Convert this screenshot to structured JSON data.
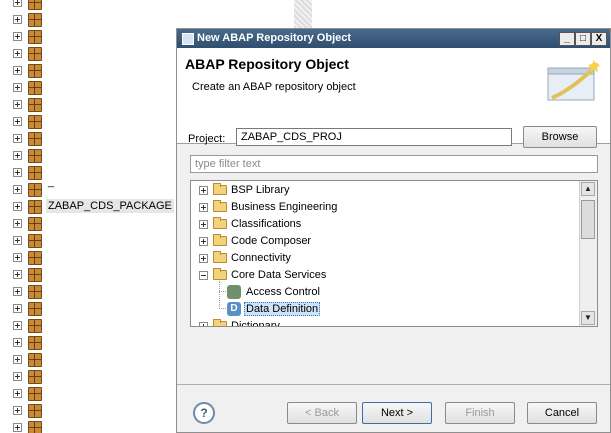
{
  "left_tree": {
    "selected_package": "ZABAP_CDS_PACKAGE",
    "cursor_text": "_"
  },
  "dialog": {
    "window_title": "New ABAP Repository Object",
    "window_buttons": {
      "minimize": "_",
      "maximize": "□",
      "close": "X"
    },
    "banner": {
      "title": "ABAP Repository Object",
      "description": "Create an ABAP repository object"
    },
    "project": {
      "label": "Project:",
      "value": "ZABAP_CDS_PROJ",
      "browse_label": "Browse"
    },
    "filter": {
      "placeholder": "type filter text"
    },
    "tree": {
      "items": [
        {
          "label": "BSP Library"
        },
        {
          "label": "Business Engineering"
        },
        {
          "label": "Classifications"
        },
        {
          "label": "Code Composer"
        },
        {
          "label": "Connectivity"
        },
        {
          "label": "Core Data Services"
        },
        {
          "label": "Access Control"
        },
        {
          "label": "Data Definition"
        },
        {
          "label": "Dictionary"
        }
      ]
    },
    "footer": {
      "help": "?",
      "back": "< Back",
      "next": "Next >",
      "finish": "Finish",
      "cancel": "Cancel"
    }
  },
  "icons": {
    "package": "package-icon",
    "folder": "folder-icon",
    "access_control": "access-control-icon",
    "data_definition": "data-definition-icon",
    "data_definition_glyph": "D",
    "access_control_glyph": "AC"
  },
  "colors": {
    "titlebar": "#2f4e70",
    "selection": "#cde3f8",
    "package": "#c68a3a",
    "folder": "#f2d27a"
  }
}
